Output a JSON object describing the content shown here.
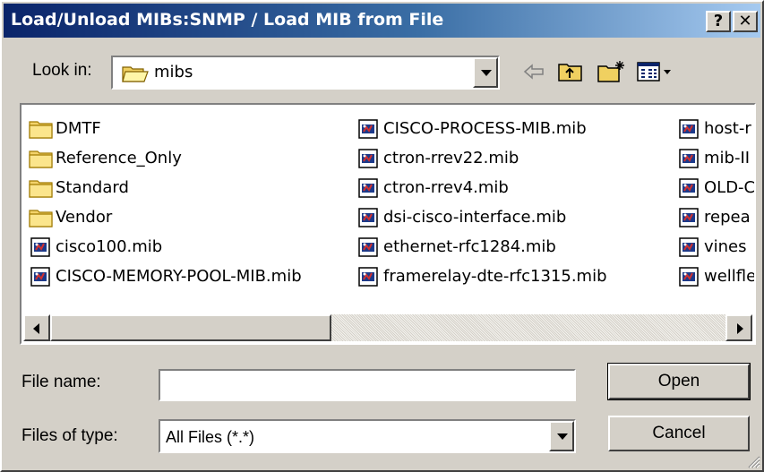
{
  "window": {
    "title": "Load/Unload MIBs:SNMP / Load MIB from File",
    "help_label": "?",
    "close_label": "✕"
  },
  "lookin": {
    "label": "Look in:",
    "value": "mibs"
  },
  "toolbar": {
    "icons": [
      "back-arrow-icon",
      "up-folder-icon",
      "new-folder-icon",
      "view-menu-icon"
    ]
  },
  "files": {
    "col1": [
      {
        "name": "DMTF",
        "type": "folder"
      },
      {
        "name": "Reference_Only",
        "type": "folder"
      },
      {
        "name": "Standard",
        "type": "folder"
      },
      {
        "name": "Vendor",
        "type": "folder"
      },
      {
        "name": "cisco100.mib",
        "type": "mib"
      },
      {
        "name": "CISCO-MEMORY-POOL-MIB.mib",
        "type": "mib"
      }
    ],
    "col2": [
      {
        "name": "CISCO-PROCESS-MIB.mib",
        "type": "mib"
      },
      {
        "name": "ctron-rrev22.mib",
        "type": "mib"
      },
      {
        "name": "ctron-rrev4.mib",
        "type": "mib"
      },
      {
        "name": "dsi-cisco-interface.mib",
        "type": "mib"
      },
      {
        "name": "ethernet-rfc1284.mib",
        "type": "mib"
      },
      {
        "name": "framerelay-dte-rfc1315.mib",
        "type": "mib"
      }
    ],
    "col3": [
      {
        "name": "host-r",
        "type": "mib"
      },
      {
        "name": "mib-II",
        "type": "mib"
      },
      {
        "name": "OLD-C",
        "type": "mib"
      },
      {
        "name": "repea",
        "type": "mib"
      },
      {
        "name": "vines",
        "type": "mib"
      },
      {
        "name": "wellfle",
        "type": "mib"
      }
    ]
  },
  "filename": {
    "label": "File name:",
    "value": ""
  },
  "filetype": {
    "label": "Files of type:",
    "value": "All Files (*.*)"
  },
  "buttons": {
    "open": "Open",
    "cancel": "Cancel"
  },
  "colors": {
    "title_start": "#0a246a",
    "title_end": "#a6caf0",
    "face": "#d4d0c8"
  }
}
